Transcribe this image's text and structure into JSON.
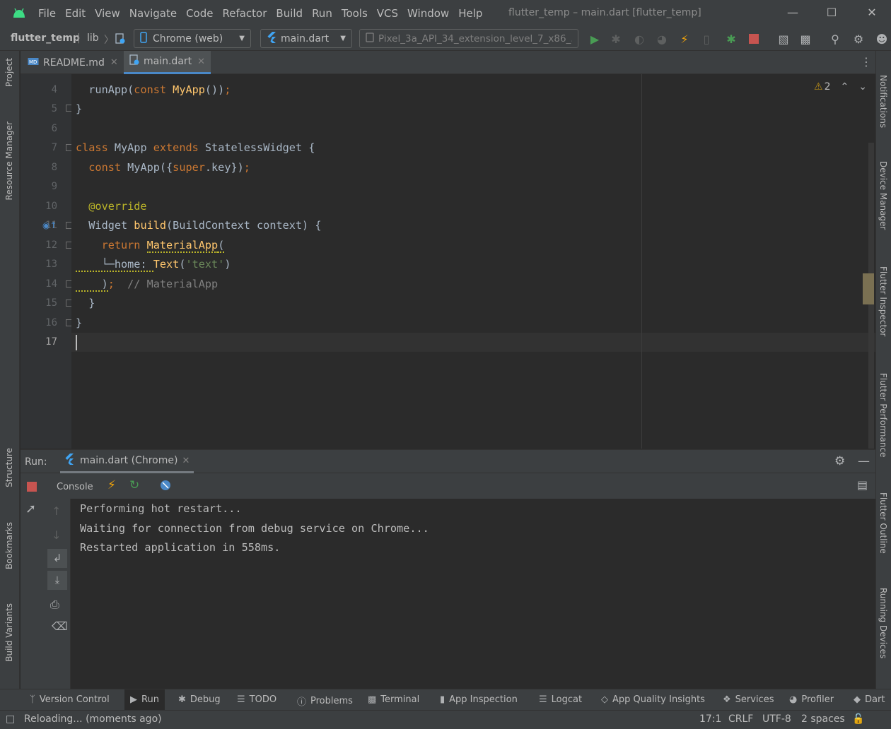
{
  "menu": {
    "items": [
      "File",
      "Edit",
      "View",
      "Navigate",
      "Code",
      "Refactor",
      "Build",
      "Run",
      "Tools",
      "VCS",
      "Window",
      "Help"
    ],
    "window_title": "flutter_temp – main.dart [flutter_temp]"
  },
  "navbar": {
    "project": "flutter_temp",
    "folder": "lib",
    "device_combo": "Chrome (web)",
    "config_combo": "main.dart",
    "emulator_combo": "Pixel_3a_API_34_extension_level_7_x86_..."
  },
  "left_strip": {
    "project": "Project",
    "resource_manager": "Resource Manager",
    "structure": "Structure",
    "bookmarks": "Bookmarks",
    "build_variants": "Build Variants"
  },
  "right_strip": {
    "notifications": "Notifications",
    "device_manager": "Device Manager",
    "flutter_inspector": "Flutter Inspector",
    "flutter_performance": "Flutter Performance",
    "flutter_outline": "Flutter Outline",
    "running_devices": "Running Devices"
  },
  "tabs": {
    "readme": "README.md",
    "main": "main.dart"
  },
  "editor": {
    "warnings_count": "2",
    "line_numbers": [
      "4",
      "5",
      "6",
      "7",
      "8",
      "9",
      "10",
      "11",
      "12",
      "13",
      "14",
      "15",
      "16",
      "17"
    ]
  },
  "run": {
    "label": "Run:",
    "tab": "main.dart (Chrome)",
    "console_tab": "Console",
    "output": [
      "Performing hot restart...",
      "Waiting for connection from debug service on Chrome...",
      "Restarted application in 558ms."
    ]
  },
  "bottom_tools": {
    "version_control": "Version Control",
    "run": "Run",
    "debug": "Debug",
    "todo": "TODO",
    "problems": "Problems",
    "terminal": "Terminal",
    "app_inspection": "App Inspection",
    "logcat": "Logcat",
    "app_quality": "App Quality Insights",
    "services": "Services",
    "profiler": "Profiler",
    "dart": "Dart"
  },
  "status": {
    "message": "Reloading... (moments ago)",
    "position": "17:1",
    "line_sep": "CRLF",
    "encoding": "UTF-8",
    "indent": "2 spaces"
  },
  "colors": {
    "accent": "#4a88c7",
    "run_green": "#499c54",
    "stop_red": "#c75450",
    "bolt_yellow": "#f0a30a"
  }
}
